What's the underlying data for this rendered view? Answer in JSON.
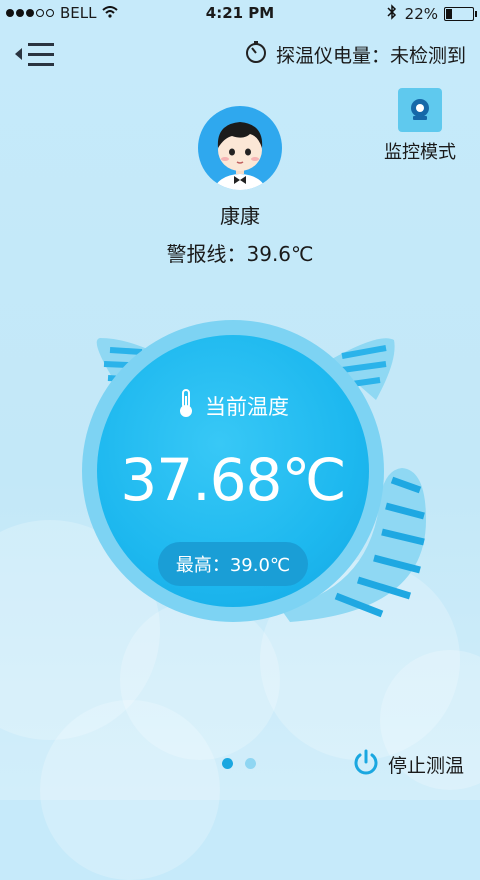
{
  "status_bar": {
    "carrier": "BELL",
    "time": "4:21 PM",
    "battery": "22%",
    "battery_level": 0.22
  },
  "header": {
    "probe_label": "探温仪电量：",
    "probe_value": "未检测到",
    "monitor_mode": "监控模式"
  },
  "profile": {
    "name": "康康",
    "alarm_line": "警报线：39.6℃"
  },
  "gauge": {
    "current_label": "当前温度",
    "current_temp": "37.68℃",
    "max": "最高：39.0℃"
  },
  "footer": {
    "stop_label": "停止测温",
    "page_count": 2,
    "current_page": 1
  },
  "colors": {
    "accent": "#1db8ef",
    "page_active": "#1aa7e0",
    "page_inactive": "#8fd6f2"
  },
  "icons": [
    "wifi-icon",
    "bluetooth-icon",
    "battery-icon",
    "menu-back-icon",
    "timer-icon",
    "camera-icon",
    "thermometer-icon",
    "power-icon"
  ]
}
